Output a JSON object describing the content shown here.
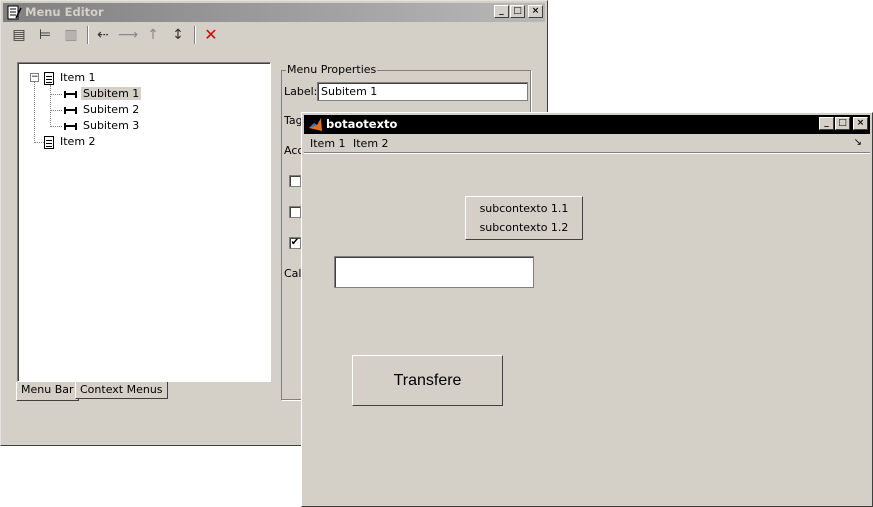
{
  "menu_editor": {
    "title": "Menu Editor",
    "window_buttons": [
      "_",
      "□",
      "×"
    ],
    "toolbar": [
      {
        "icon": "new-menu-icon",
        "glyph": "▤"
      },
      {
        "icon": "new-menu-item-icon",
        "glyph": "⊨"
      },
      {
        "icon": "new-context-menu-icon",
        "glyph": "▥"
      },
      {
        "icon": "move-left-icon",
        "glyph": "⇠"
      },
      {
        "icon": "move-right-icon",
        "glyph": "⟶"
      },
      {
        "icon": "move-up-icon",
        "glyph": "↑"
      },
      {
        "icon": "move-down-icon",
        "glyph": "↕"
      },
      {
        "icon": "delete-icon",
        "glyph": "✕",
        "color": "#e00000"
      }
    ],
    "tree": {
      "item1": "Item 1",
      "sub1": "Subitem 1",
      "sub2": "Subitem 2",
      "sub3": "Subitem 3",
      "item2": "Item 2"
    },
    "tabs": {
      "menu_bar": "Menu Bar",
      "context_menus": "Context Menus"
    },
    "properties": {
      "group_title": "Menu Properties",
      "label_label": "Label:",
      "label_value": "Subitem 1",
      "tag_label": "Tag",
      "accel_label": "Acc",
      "callback_label": "Call",
      "checkboxes": [
        false,
        false,
        true
      ]
    }
  },
  "figure": {
    "title": "botaotexto",
    "window_buttons": [
      "_",
      "□",
      "×"
    ],
    "menu": [
      "Item 1",
      "Item 2"
    ],
    "dock_glyph": "↘",
    "context_items": [
      "subcontexto 1.1",
      "subcontexto 1.2"
    ],
    "edit_value": "",
    "button_label": "Transfere"
  },
  "colors": {
    "window_bg": "#d4d0c8",
    "active_title": "#000000",
    "inactive_title": "#808080",
    "delete_red": "#e00000"
  }
}
